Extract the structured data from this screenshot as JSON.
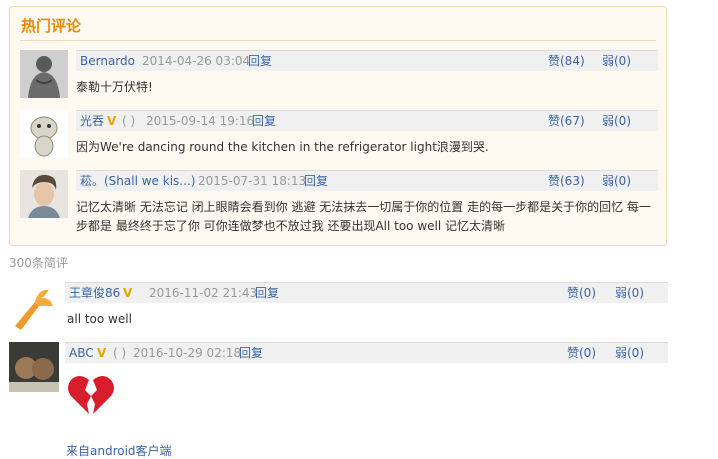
{
  "hot_section": {
    "title": "热门评论",
    "comments": [
      {
        "user": "Bernardo",
        "badge": "",
        "date": "2014-04-26 03:04",
        "reply": "回复",
        "like": "赞(84)",
        "weak": "弱(0)",
        "text": "泰勒十万伏特!"
      },
      {
        "user": "光吞",
        "badge": "V",
        "extra": "( )",
        "date": "2015-09-14 19:16",
        "reply": "回复",
        "like": "赞(67)",
        "weak": "弱(0)",
        "text": "因为We're dancing round the kitchen in the refrigerator light浪漫到哭."
      },
      {
        "user": "菘。(Shall we kis...)",
        "badge": "",
        "date": "2015-07-31 18:13",
        "reply": "回复",
        "like": "赞(63)",
        "weak": "弱(0)",
        "text": "记忆太清晰 无法忘记 闭上眼睛会看到你 逃避 无法抹去一切属于你的位置 走的每一步都是关于你的回忆 每一步都是 最终终于忘了你 可你连做梦也不放过我 还要出现All too well 记忆太清晰"
      }
    ]
  },
  "short_count": "300条简评",
  "short_comments": [
    {
      "user": "王章俊86",
      "badge": "V",
      "date": "2016-11-02 21:43",
      "reply": "回复",
      "like": "赞(0)",
      "weak": "弱(0)",
      "text": "all too well"
    },
    {
      "user": "ABC",
      "badge": "V",
      "extra": "( )",
      "date": "2016-10-29 02:18",
      "reply": "回复",
      "like": "赞(0)",
      "weak": "弱(0)",
      "text": "💔",
      "source": "来自android客户端"
    }
  ],
  "colors": {
    "accent": "#e88a00",
    "link": "#3b64a4",
    "muted": "#999999"
  }
}
